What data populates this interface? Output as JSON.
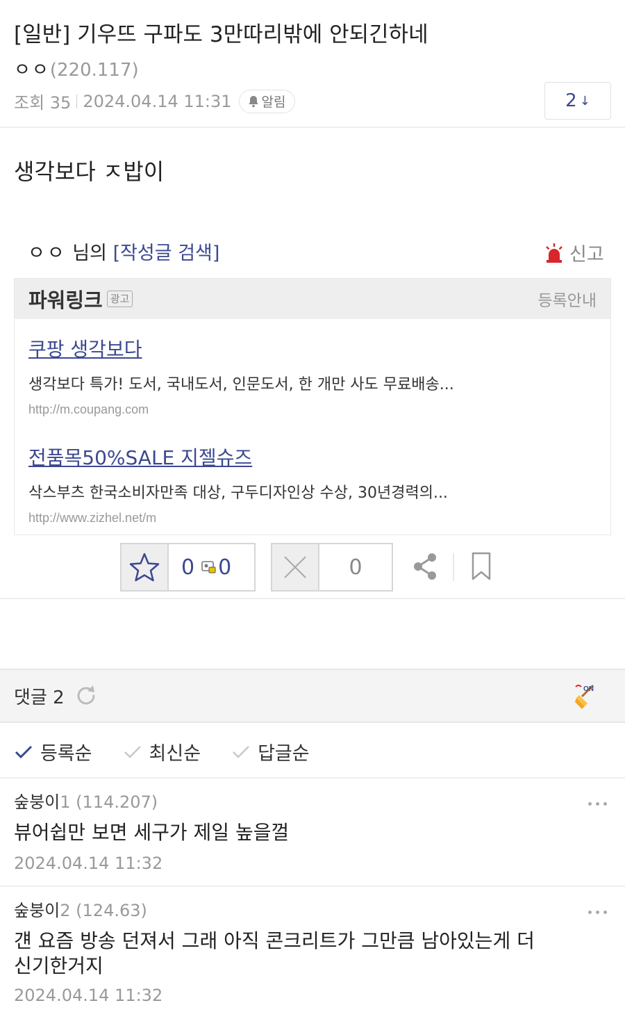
{
  "post": {
    "title": "[일반] 기우뜨 구파도 3만따리밖에 안되긴하네",
    "author": "ㅇㅇ",
    "author_ip": "(220.117)",
    "views_label": "조회 35",
    "datetime": "2024.04.14 11:31",
    "alarm_label": "알림",
    "comment_count_button": "2",
    "comment_count_arrow": "↓",
    "body": "생각보다 ㅈ밥이"
  },
  "writer_search": {
    "name": "ㅇㅇ",
    "suffix": "님의",
    "link": "[작성글 검색]",
    "report_label": "신고"
  },
  "powerlink": {
    "title": "파워링크",
    "ad_badge": "광고",
    "register_label": "등록안내",
    "items": [
      {
        "title": "쿠팡 생각보다",
        "desc": "생각보다 특가! 도서, 국내도서, 인문도서, 한 개만 사도 무료배송...",
        "url": "http://m.coupang.com"
      },
      {
        "title": "전품목50%SALE 지젤슈즈",
        "desc": "삭스부츠 한국소비자만족 대상, 구두디자인상 수상, 30년경력의...",
        "url": "http://www.zizhel.net/m"
      }
    ]
  },
  "votes": {
    "recommend": "0",
    "fixed_recommend": "0",
    "not_recommend": "0"
  },
  "comments_section": {
    "label": "댓글 2",
    "sort_tabs": [
      {
        "label": "등록순",
        "active": true
      },
      {
        "label": "최신순",
        "active": false
      },
      {
        "label": "답글순",
        "active": false
      }
    ],
    "comments": [
      {
        "nick": "숲붕이",
        "nick_num": "1",
        "ip": " (114.207)",
        "text": "뷰어쉽만 보면 세구가 제일 높을껄",
        "date": "2024.04.14 11:32"
      },
      {
        "nick": "숲붕이",
        "nick_num": "2",
        "ip": " (124.63)",
        "text": "걘 요즘 방송 던져서 그래 아직 콘크리트가 그만큼 남아있는게 더 신기한거지",
        "date": "2024.04.14 11:32"
      }
    ]
  },
  "colors": {
    "accent": "#3b4890",
    "report_red": "#d9262c",
    "muted": "#999999"
  }
}
